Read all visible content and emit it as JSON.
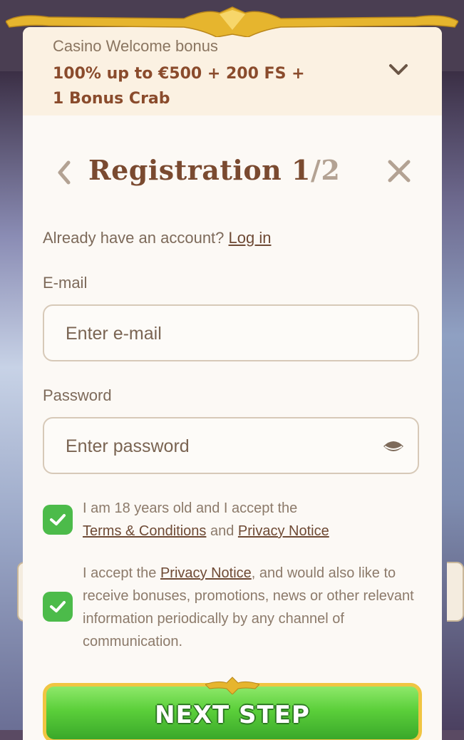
{
  "bonus": {
    "label": "Casino Welcome bonus",
    "offer_line1": "100% up to €500 + 200 FS +",
    "offer_line2": "1 Bonus Crab"
  },
  "header": {
    "title_main": "Registration 1",
    "title_sep": "/",
    "title_total": "2"
  },
  "login_prompt": {
    "text": "Already have an account?",
    "link": "Log in"
  },
  "email": {
    "label": "E-mail",
    "placeholder": "Enter e-mail"
  },
  "password": {
    "label": "Password",
    "placeholder": "Enter password"
  },
  "consent_age": {
    "checked": true,
    "text_before": "I am 18 years old and I accept the",
    "terms_link": "Terms & Conditions",
    "and": "and",
    "privacy_link": "Privacy Notice"
  },
  "consent_marketing": {
    "checked": true,
    "text_before": "I accept the",
    "privacy_link": "Privacy Notice",
    "text_after": ", and would also like to receive bonuses, promotions, news or other relevant information periodically by any channel of communication."
  },
  "next_button": {
    "label": "NEXT STEP"
  },
  "colors": {
    "accent_green": "#4cbb4a",
    "title_brown": "#7a4a30",
    "gold": "#f0c542"
  }
}
